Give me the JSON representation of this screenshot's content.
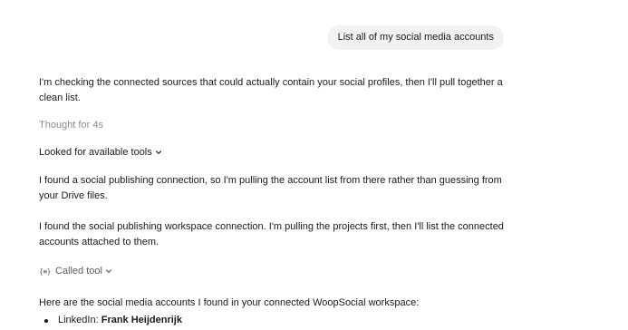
{
  "user_message": "List all of my social media accounts",
  "assistant": {
    "intro": "I'm checking the connected sources that could actually contain your social profiles, then I'll pull together a clean list.",
    "thought": "Thought for 4s",
    "looked_for_tools": "Looked for available tools",
    "para_found_connection": "I found a social publishing connection, so I'm pulling the account list from there rather than guessing from your Drive files.",
    "para_workspace": "I found the social publishing workspace connection. I'm pulling the projects first, then I'll list the connected accounts attached to them.",
    "called_tool": "Called tool",
    "called_tool_icon": "braces-icon",
    "summary": "Here are the social media accounts I found in your connected WoopSocial workspace:",
    "accounts": [
      {
        "platform": "LinkedIn:",
        "name": "Frank Heijdenrijk"
      }
    ]
  }
}
